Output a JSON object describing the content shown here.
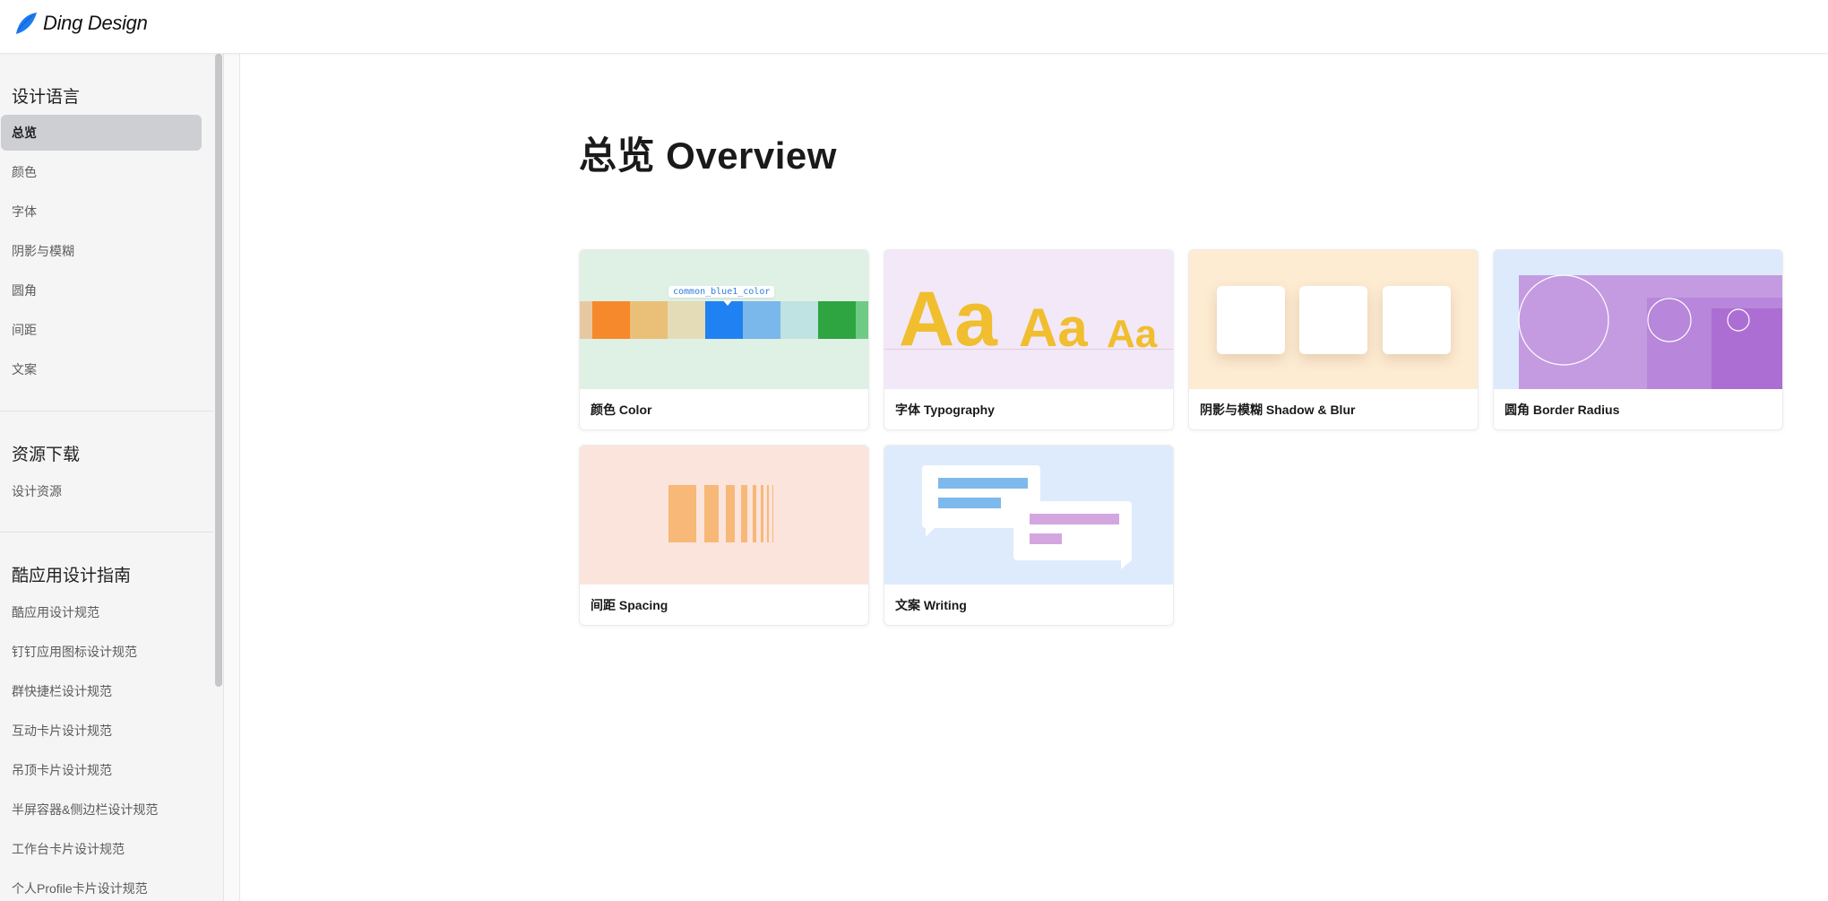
{
  "header": {
    "logo_text": "Ding Design"
  },
  "sidebar": {
    "groups": [
      {
        "title": "设计语言",
        "items": [
          "总览",
          "颜色",
          "字体",
          "阴影与模糊",
          "圆角",
          "间距",
          "文案"
        ]
      },
      {
        "title": "资源下载",
        "items": [
          "设计资源"
        ]
      },
      {
        "title": "酷应用设计指南",
        "items": [
          "酷应用设计规范",
          "钉钉应用图标设计规范",
          "群快捷栏设计规范",
          "互动卡片设计规范",
          "吊顶卡片设计规范",
          "半屏容器&侧边栏设计规范",
          "工作台卡片设计规范",
          "个人Profile卡片设计规范"
        ]
      }
    ],
    "active_item": "总览"
  },
  "main": {
    "title": "总览 Overview",
    "cards": [
      {
        "label": "颜色 Color",
        "preview_bg": "#dff0e4"
      },
      {
        "label": "字体 Typography",
        "preview_bg": "#f2e8f7"
      },
      {
        "label": "阴影与模糊 Shadow & Blur",
        "preview_bg": "#fdebd2"
      },
      {
        "label": "圆角 Border Radius",
        "preview_bg": "#dceafb"
      },
      {
        "label": "间距 Spacing",
        "preview_bg": "#fbe4dc"
      },
      {
        "label": "文案 Writing",
        "preview_bg": "#deebfc"
      }
    ],
    "color_card": {
      "tooltip": "common_blue1_color",
      "swatches": [
        "#e6c9a0",
        "#f5892b",
        "#eabf78",
        "#e3dcb7",
        "#2081f2",
        "#7ab7ea",
        "#bfe2e2",
        "#2ea541",
        "#6fcb84"
      ]
    },
    "type_card": {
      "glyph": "Aa"
    }
  }
}
